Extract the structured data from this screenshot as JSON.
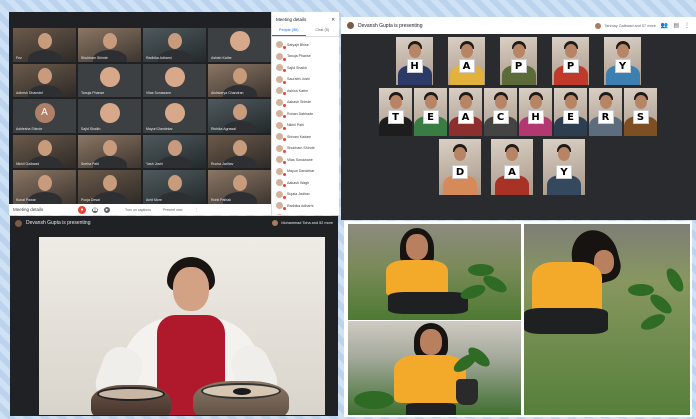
{
  "meeting_grid": {
    "participants": [
      "Fez",
      "Shubham Shinde",
      "Radhika Adharni",
      "Ashish Kathe",
      "Adhesh Dhamdel",
      "Tanuja Phanse",
      "Vilas Sonawane",
      "Aishwarya Chandran",
      "Ashlesha Shinde",
      "Sajid Shaikh",
      "Mayuri Dandekar",
      "Rishika Agrawal",
      "Nikhil Gaikwad",
      "Sneha Patil",
      "Yash Joshi",
      "Rucha Jadhav",
      "Kunal Pawar",
      "Pooja Desai",
      "Amit More",
      "Rohit Pathak"
    ],
    "avatar_letter": "A",
    "bottombar": {
      "meeting_details": "Meeting details",
      "captions_label": "Turn on captions",
      "present_label": "Present now",
      "more_icon": "more-vert-icon"
    },
    "side_panel": {
      "title": "Meeting details",
      "close": "✕",
      "tabs": [
        "People (56)",
        "Chat (5)"
      ],
      "people": [
        "Satyajit Bhise",
        "Tanuja Phanse",
        "Sajid Shaikh",
        "Saurabh Joshi",
        "Ashish Kathe",
        "Aakash Shinde",
        "Rohan Dabhade",
        "Nikhil Patil",
        "Shivani Kadam",
        "Shubham Shinde",
        "Vilas Sonawane",
        "Mayuri Dandekar",
        "Aakash Wagh",
        "Sujata Jadhav",
        "Radhika Adharni",
        "Amol Shirke"
      ]
    }
  },
  "teachers_day": {
    "presenting": "Devansh Gupta is presenting",
    "others": "Tanmay Gaikwad and 57 more",
    "icons": [
      "people-icon",
      "chat-icon",
      "more-icon"
    ],
    "letters": [
      "H",
      "A",
      "P",
      "P",
      "Y",
      "T",
      "E",
      "A",
      "C",
      "H",
      "E",
      "R",
      "S",
      "D",
      "A",
      "Y"
    ],
    "shirt_colors": [
      "#2b3a67",
      "#e3b23c",
      "#5b6b3a",
      "#c0392b",
      "#3c7fb1",
      "#1d1d1d",
      "#3a7d44",
      "#8e2f2f",
      "#444444",
      "#b33771",
      "#2c3e50",
      "#5d6d7e",
      "#7f4f24",
      "#d68a59",
      "#a93226",
      "#34495e"
    ]
  },
  "tabla_panel": {
    "presenting": "Devansh Gupta is presenting",
    "others": "Mohammad Toha and 52 more"
  },
  "colors": {
    "meet_dark": "#202124",
    "end_call_red": "#ea4335",
    "accent_blue": "#1a73e8",
    "vest_red": "#b0192b",
    "shirt_yellow": "#f3a92a"
  }
}
